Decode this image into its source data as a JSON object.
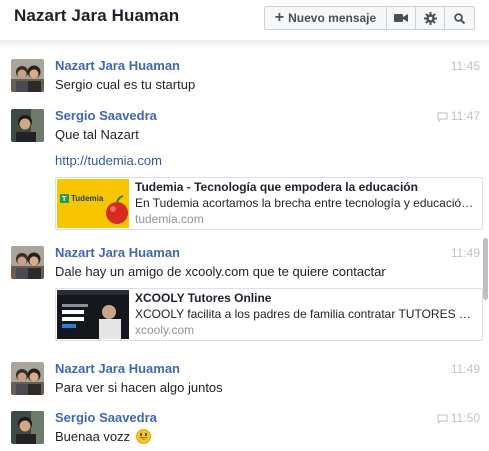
{
  "header": {
    "title": "Nazart Jara Huaman",
    "new_message_label": "Nuevo mensaje",
    "icons": [
      "plus-icon",
      "video-icon",
      "gear-icon",
      "search-icon"
    ]
  },
  "messages": [
    {
      "sender": "Nazart Jara Huaman",
      "time": "11:45",
      "text": "Sergio cual es tu startup"
    },
    {
      "sender": "Sergio Saavedra",
      "time": "11:47",
      "text": "Que tal Nazart",
      "link": "http://tudemia.com",
      "card": {
        "title": "Tudemia - Tecnología que empodera la educación",
        "description": "En Tudemia acortamos la brecha entre tecnología y educació…",
        "domain": "tudemia.com",
        "thumb_label": "Tudemia"
      }
    },
    {
      "sender": "Nazart Jara Huaman",
      "time": "11:49",
      "text": "Dale hay un amigo de xcooly.com que te quiere contactar",
      "card": {
        "title": "XCOOLY Tutores Online",
        "description": "XCOOLY facilita a los padres de familia contratar TUTORES O…",
        "domain": "xcooly.com"
      }
    },
    {
      "sender": "Nazart Jara Huaman",
      "time": "11:49",
      "text": "Para ver si hacen algo juntos"
    },
    {
      "sender": "Sergio Saavedra",
      "time": "11:50",
      "text": "Buenaa vozz",
      "emoji": "😃"
    }
  ],
  "colors": {
    "sender": "#4267b2",
    "link": "#365899",
    "time": "#bec3c9",
    "tudemia_yellow": "#f7c600"
  }
}
